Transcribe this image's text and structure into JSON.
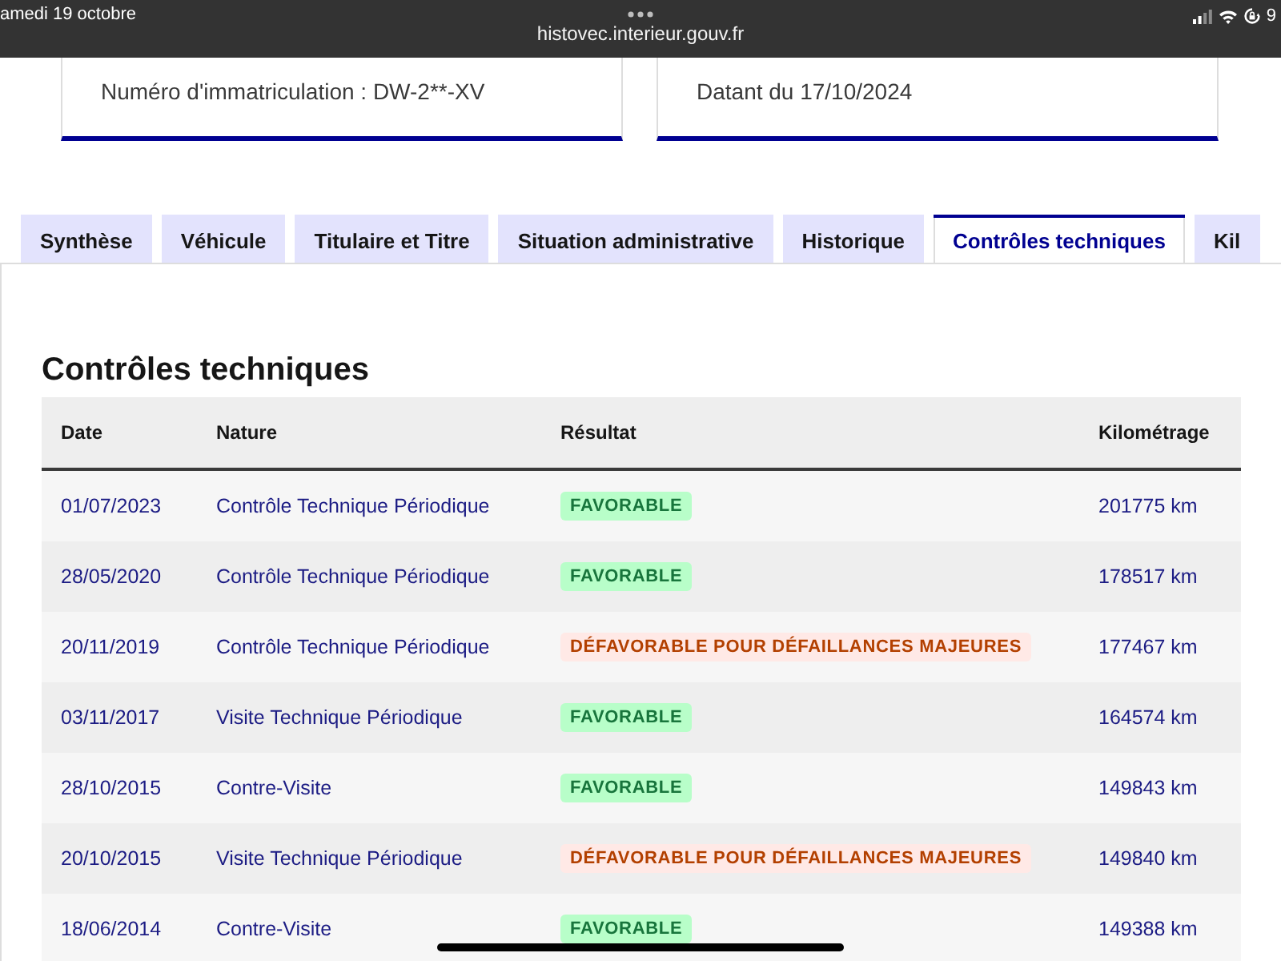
{
  "status_bar": {
    "date": "amedi 19 octobre",
    "url": "histovec.interieur.gouv.fr",
    "battery": "9"
  },
  "cards": [
    {
      "text": "Numéro d'immatriculation : DW-2**-XV"
    },
    {
      "text": "Datant du 17/10/2024"
    }
  ],
  "tabs": [
    {
      "label": "Synthèse",
      "selected": false
    },
    {
      "label": "Véhicule",
      "selected": false
    },
    {
      "label": "Titulaire et Titre",
      "selected": false
    },
    {
      "label": "Situation administrative",
      "selected": false
    },
    {
      "label": "Historique",
      "selected": false
    },
    {
      "label": "Contrôles techniques",
      "selected": true
    },
    {
      "label": "Kil",
      "selected": false
    }
  ],
  "section": {
    "title": "Contrôles techniques"
  },
  "table": {
    "columns": [
      "Date",
      "Nature",
      "Résultat",
      "Kilométrage"
    ],
    "rows": [
      {
        "date": "01/07/2023",
        "nature": "Contrôle Technique Périodique",
        "result": {
          "label": "FAVORABLE",
          "kind": "favorable"
        },
        "mileage": "201775 km"
      },
      {
        "date": "28/05/2020",
        "nature": "Contrôle Technique Périodique",
        "result": {
          "label": "FAVORABLE",
          "kind": "favorable"
        },
        "mileage": "178517 km"
      },
      {
        "date": "20/11/2019",
        "nature": "Contrôle Technique Périodique",
        "result": {
          "label": "DÉFAVORABLE POUR DÉFAILLANCES MAJEURES",
          "kind": "unfavorable"
        },
        "mileage": "177467 km"
      },
      {
        "date": "03/11/2017",
        "nature": "Visite Technique Périodique",
        "result": {
          "label": "FAVORABLE",
          "kind": "favorable"
        },
        "mileage": "164574 km"
      },
      {
        "date": "28/10/2015",
        "nature": "Contre-Visite",
        "result": {
          "label": "FAVORABLE",
          "kind": "favorable"
        },
        "mileage": "149843 km"
      },
      {
        "date": "20/10/2015",
        "nature": "Visite Technique Périodique",
        "result": {
          "label": "DÉFAVORABLE POUR DÉFAILLANCES MAJEURES",
          "kind": "unfavorable"
        },
        "mileage": "149840 km"
      },
      {
        "date": "18/06/2014",
        "nature": "Contre-Visite",
        "result": {
          "label": "FAVORABLE",
          "kind": "favorable"
        },
        "mileage": "149388 km"
      }
    ]
  }
}
